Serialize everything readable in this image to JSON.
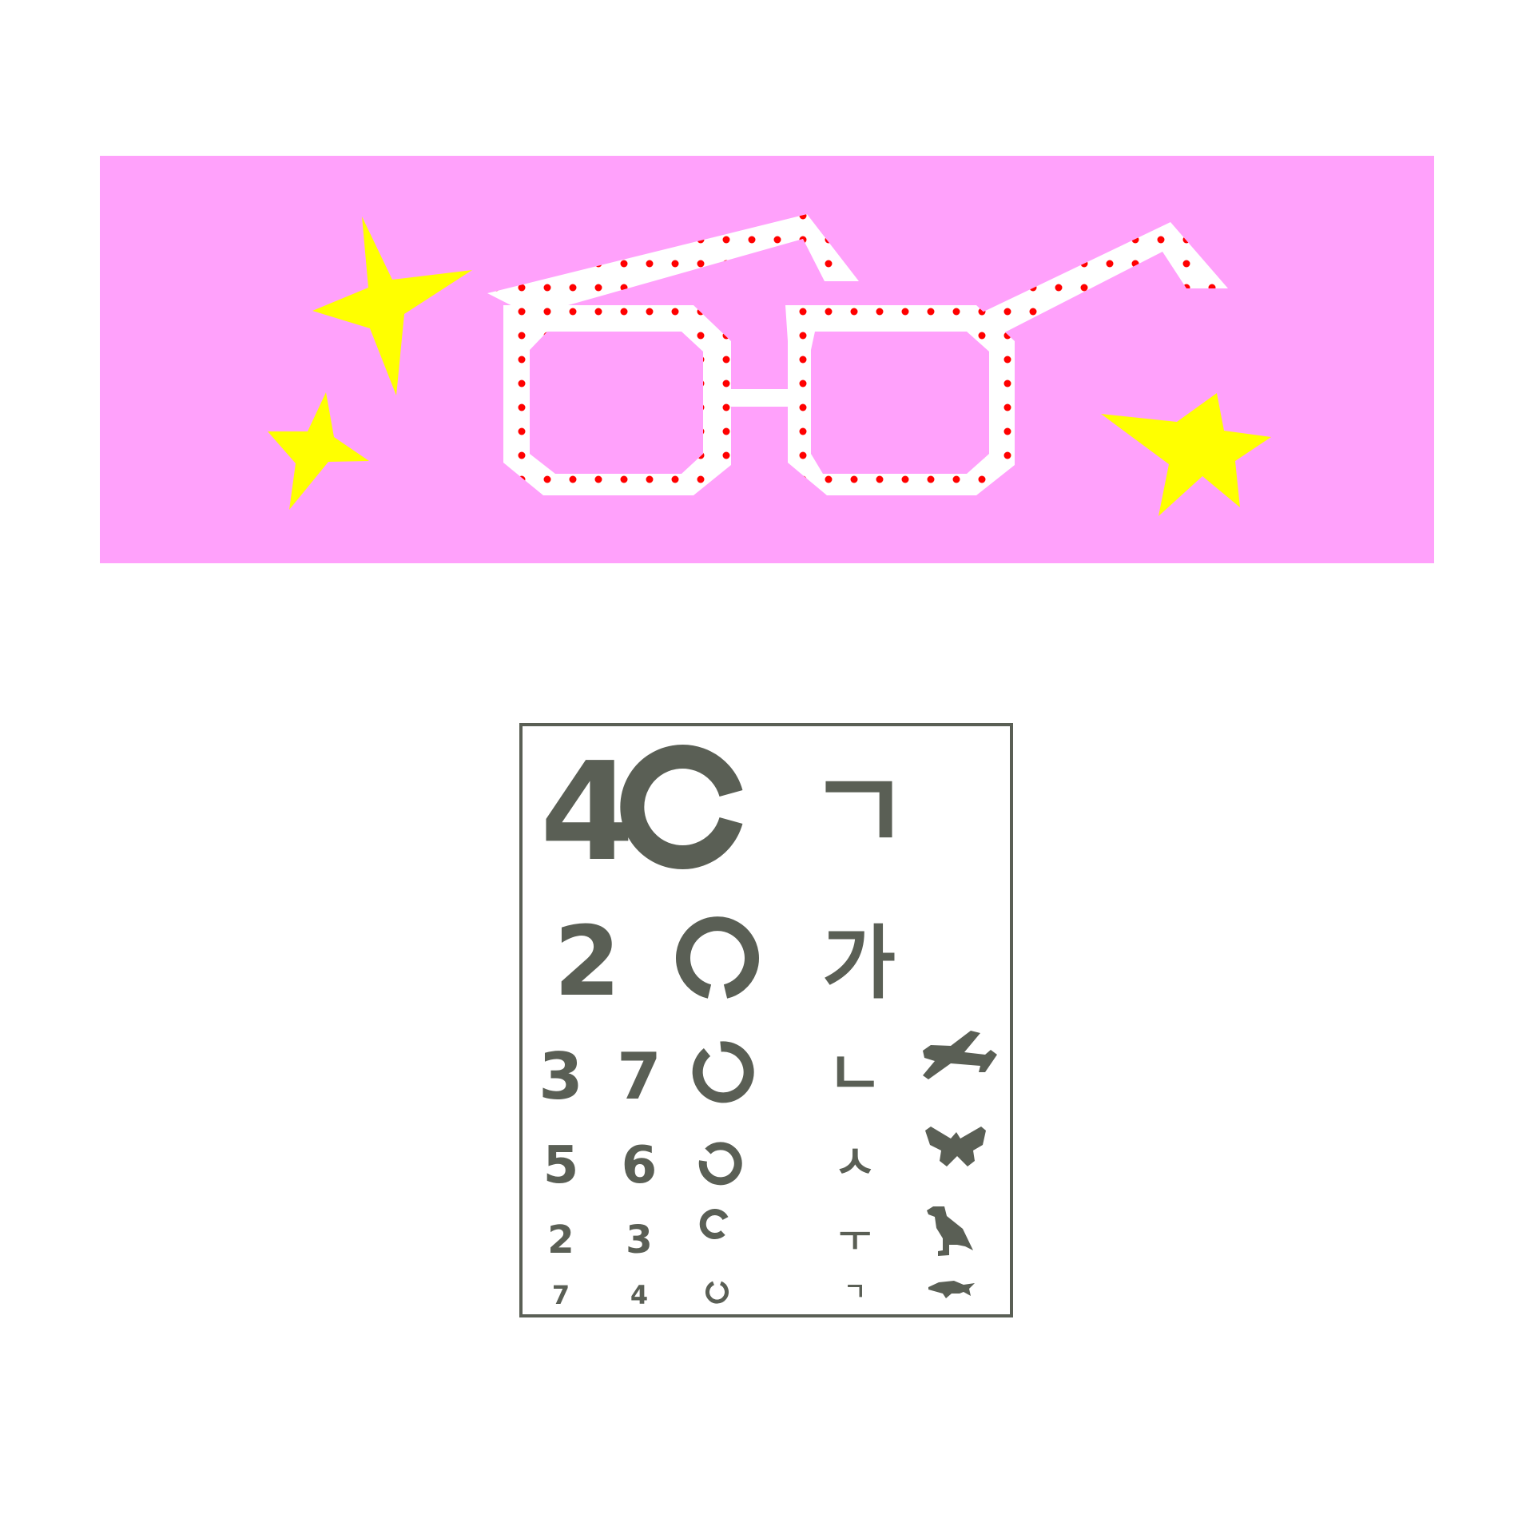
{
  "colors": {
    "banner_bg": "#ffa1fb",
    "star": "#ffff00",
    "glasses_frame": "#ffffff",
    "glasses_dots": "#ff0000",
    "chart_ink": "#5a5f55"
  },
  "eye_chart": {
    "rows": [
      [
        "4",
        "ring",
        "ㄱ"
      ],
      [
        "2",
        "ring",
        "가"
      ],
      [
        "3",
        "7",
        "ring",
        "ㄴ",
        "airplane-icon"
      ],
      [
        "5",
        "6",
        "ring",
        "ㅅ",
        "butterfly-icon"
      ],
      [
        "2",
        "3",
        "ring",
        "ㅜ",
        "bird-icon"
      ],
      [
        "7",
        "4",
        "ring",
        "ㄱ",
        "fish-icon"
      ]
    ],
    "text": {
      "r1c1": "4",
      "r1c3": "ㄱ",
      "r2c1": "2",
      "r2c3": "가",
      "r3c1": "3",
      "r3c2": "7",
      "r3c4": "ㄴ",
      "r4c1": "5",
      "r4c2": "6",
      "r4c4": "ㅅ",
      "r5c1": "2",
      "r5c2": "3",
      "r5c4": "ㅜ",
      "r6c1": "7",
      "r6c2": "4",
      "r6c4": "ㄱ"
    }
  }
}
